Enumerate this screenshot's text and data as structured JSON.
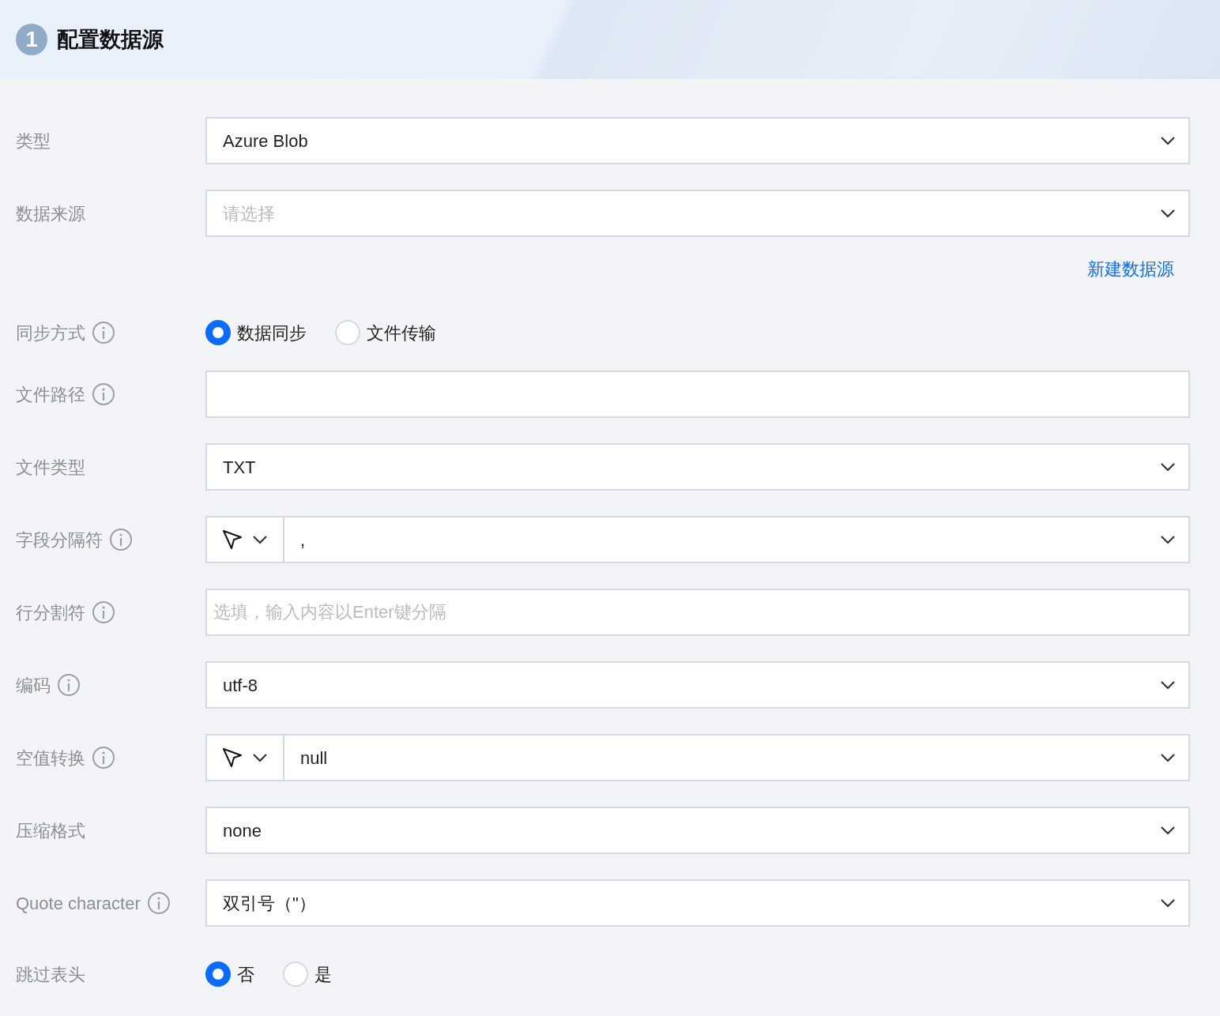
{
  "header": {
    "step": "1",
    "title": "配置数据源"
  },
  "fields": [
    {
      "kind": "select",
      "label": "类型",
      "info": false,
      "value": "Azure Blob"
    },
    {
      "kind": "select",
      "label": "数据来源",
      "info": false,
      "placeholder": "请选择",
      "link": "新建数据源"
    },
    {
      "kind": "radio",
      "label": "同步方式",
      "info": true,
      "options": [
        {
          "label": "数据同步",
          "selected": true
        },
        {
          "label": "文件传输",
          "selected": false
        }
      ]
    },
    {
      "kind": "input",
      "label": "文件路径",
      "info": true
    },
    {
      "kind": "select",
      "label": "文件类型",
      "info": false,
      "value": "TXT"
    },
    {
      "kind": "split",
      "label": "字段分隔符",
      "info": true,
      "value": ","
    },
    {
      "kind": "input",
      "label": "行分割符",
      "info": true,
      "placeholder": "选填，输入内容以Enter键分隔"
    },
    {
      "kind": "select",
      "label": "编码",
      "info": true,
      "value": "utf-8"
    },
    {
      "kind": "split",
      "label": "空值转换",
      "info": true,
      "value": "null"
    },
    {
      "kind": "select",
      "label": "压缩格式",
      "info": false,
      "value": "none"
    },
    {
      "kind": "select",
      "label": "Quote character",
      "info": true,
      "value": "双引号（\"）"
    },
    {
      "kind": "radio",
      "label": "跳过表头",
      "info": false,
      "options": [
        {
          "label": "否",
          "selected": true
        },
        {
          "label": "是",
          "selected": false
        }
      ]
    }
  ]
}
